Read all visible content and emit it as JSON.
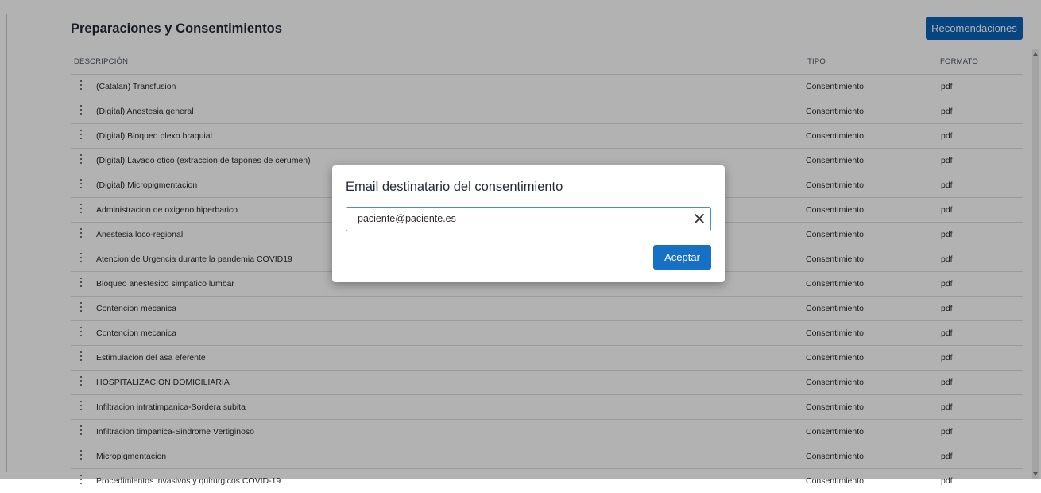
{
  "header": {
    "title": "Preparaciones y Consentimientos",
    "recommendations_label": "Recomendaciones"
  },
  "table": {
    "columns": {
      "description": "DESCRIPCIÓN",
      "type": "TIPO",
      "format": "FORMATO"
    },
    "rows": [
      {
        "description": "(Catalan) Transfusion",
        "type": "Consentimiento",
        "format": "pdf"
      },
      {
        "description": "(Digital) Anestesia general",
        "type": "Consentimiento",
        "format": "pdf"
      },
      {
        "description": "(Digital) Bloqueo plexo braquial",
        "type": "Consentimiento",
        "format": "pdf"
      },
      {
        "description": "(Digital) Lavado otico (extraccion de tapones de cerumen)",
        "type": "Consentimiento",
        "format": "pdf"
      },
      {
        "description": "(Digital) Micropigmentacion",
        "type": "Consentimiento",
        "format": "pdf"
      },
      {
        "description": "Administracion de oxigeno hiperbarico",
        "type": "Consentimiento",
        "format": "pdf"
      },
      {
        "description": "Anestesia loco-regional",
        "type": "Consentimiento",
        "format": "pdf"
      },
      {
        "description": "Atencion de Urgencia durante la pandemia COVID19",
        "type": "Consentimiento",
        "format": "pdf"
      },
      {
        "description": "Bloqueo anestesico simpatico lumbar",
        "type": "Consentimiento",
        "format": "pdf"
      },
      {
        "description": "Contencion mecanica",
        "type": "Consentimiento",
        "format": "pdf"
      },
      {
        "description": "Contencion mecanica",
        "type": "Consentimiento",
        "format": "pdf"
      },
      {
        "description": "Estimulacion del asa eferente",
        "type": "Consentimiento",
        "format": "pdf"
      },
      {
        "description": "HOSPITALIZACION DOMICILIARIA",
        "type": "Consentimiento",
        "format": "pdf"
      },
      {
        "description": "Infiltracion intratimpanica-Sordera subita",
        "type": "Consentimiento",
        "format": "pdf"
      },
      {
        "description": "Infiltracion timpanica-Sindrome Vertiginoso",
        "type": "Consentimiento",
        "format": "pdf"
      },
      {
        "description": "Micropigmentacion",
        "type": "Consentimiento",
        "format": "pdf"
      },
      {
        "description": "Procedimientos invasivos y quirurgicos COVID-19",
        "type": "Consentimiento",
        "format": "pdf"
      }
    ]
  },
  "dialog": {
    "title": "Email destinatario del consentimiento",
    "email_value": "paciente@paciente.es",
    "clear_icon": "close-icon",
    "accept_label": "Aceptar"
  },
  "colors": {
    "primary_button": "#0a63b8",
    "accept_button": "#1670c5",
    "overlay": "rgba(0,0,0,0.30)"
  }
}
